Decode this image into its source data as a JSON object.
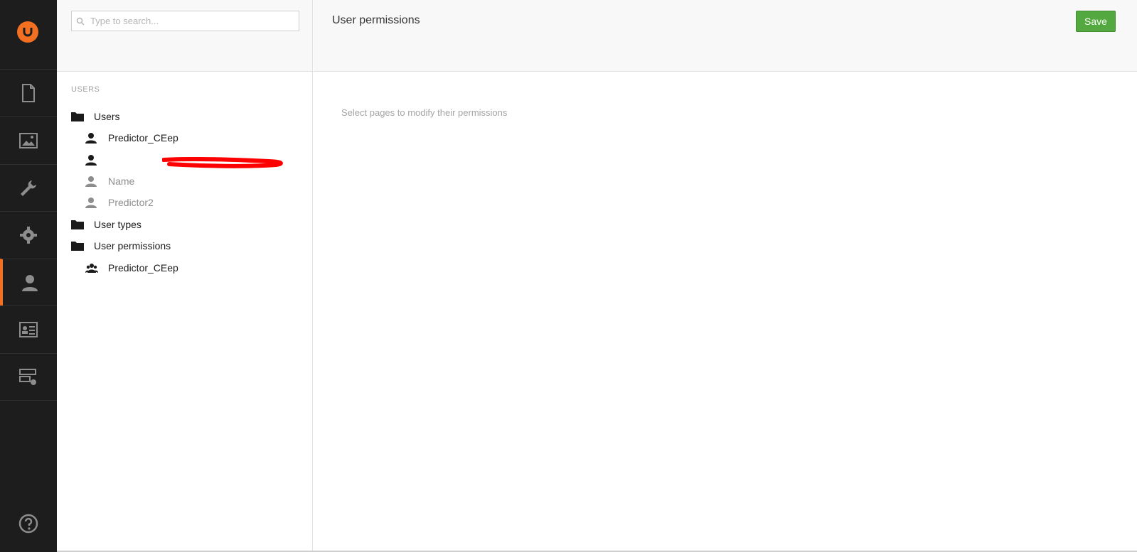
{
  "search": {
    "placeholder": "Type to search..."
  },
  "tree": {
    "section_title": "USERS",
    "nodes": [
      {
        "label": "Users"
      },
      {
        "label": "Predictor_CEep"
      },
      {
        "label": ""
      },
      {
        "label": "Name"
      },
      {
        "label": "Predictor2"
      },
      {
        "label": "User types"
      },
      {
        "label": "User permissions"
      },
      {
        "label": "Predictor_CEep"
      }
    ]
  },
  "main": {
    "title": "User permissions",
    "save_label": "Save",
    "hint": "Select pages to modify their permissions"
  },
  "colors": {
    "accent": "#f36f21",
    "save": "#53a93f",
    "sidebar": "#1d1d1d"
  },
  "icons": [
    "umbraco-logo-icon",
    "content-icon",
    "media-icon",
    "settings-icon",
    "developer-icon",
    "users-icon",
    "members-icon",
    "forms-icon",
    "help-icon"
  ]
}
